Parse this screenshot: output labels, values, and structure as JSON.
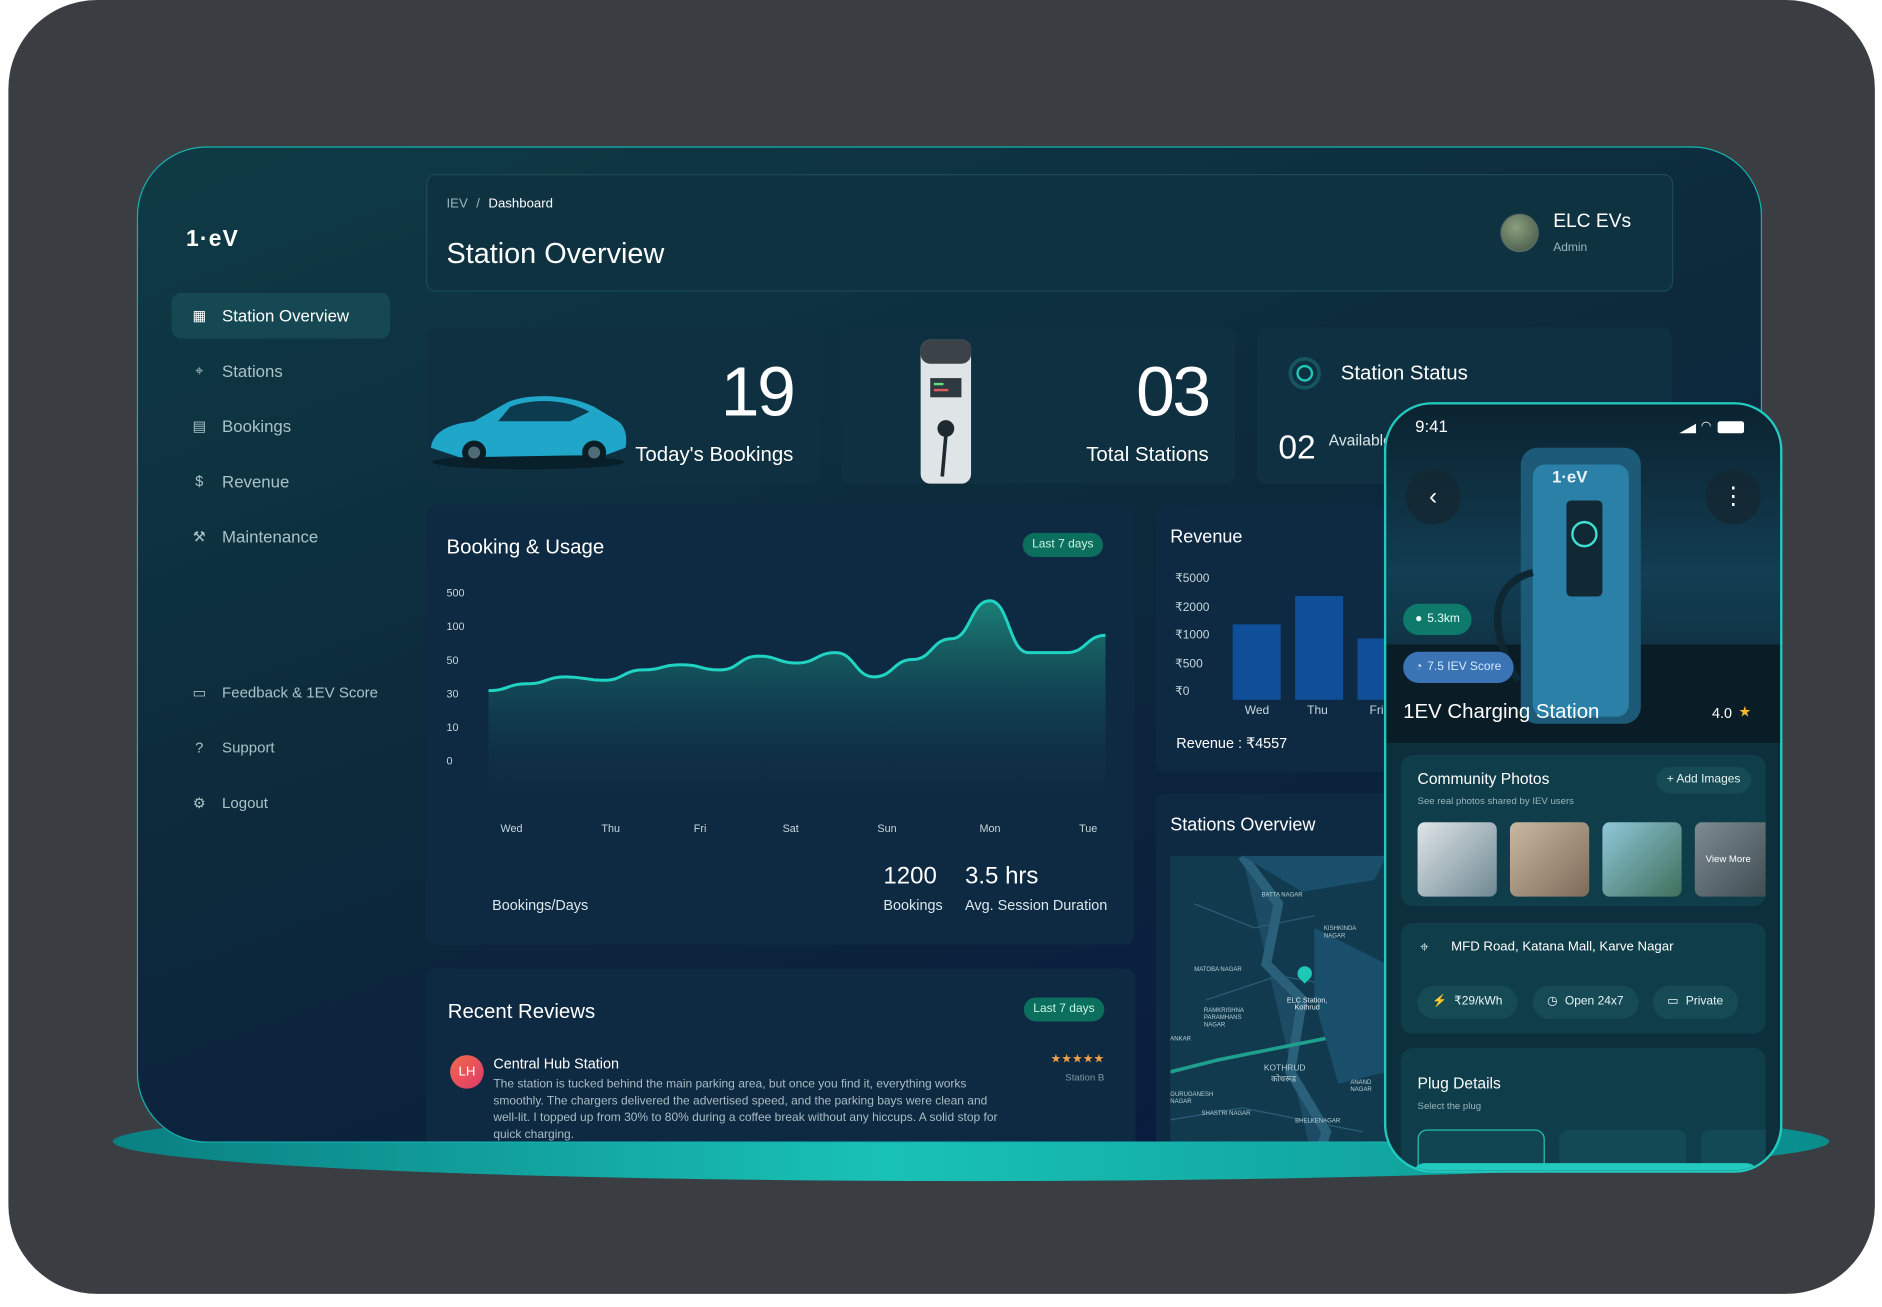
{
  "app": {
    "logo": "1·eV"
  },
  "nav": {
    "items": [
      {
        "label": "Station Overview",
        "icon": "grid-icon",
        "active": true
      },
      {
        "label": "Stations",
        "icon": "map-pin-icon"
      },
      {
        "label": "Bookings",
        "icon": "calendar-icon"
      },
      {
        "label": "Revenue",
        "icon": "dollar-icon"
      },
      {
        "label": "Maintenance",
        "icon": "wrench-icon"
      }
    ],
    "lower_items": [
      {
        "label": "Feedback & 1EV Score",
        "icon": "chat-icon"
      },
      {
        "label": "Support",
        "icon": "help-icon"
      },
      {
        "label": "Logout",
        "icon": "gear-icon"
      }
    ]
  },
  "header": {
    "breadcrumb_root": "IEV",
    "breadcrumb_sep": "/",
    "breadcrumb_current": "Dashboard",
    "title": "Station Overview",
    "user_name": "ELC EVs",
    "user_role": "Admin"
  },
  "cards": {
    "bookings": {
      "value": "19",
      "label": "Today's Bookings"
    },
    "stations": {
      "value": "03",
      "label": "Total Stations"
    },
    "status": {
      "title": "Station Status",
      "value": "02",
      "label": "Available"
    }
  },
  "booking_usage": {
    "title": "Booking & Usage",
    "range": "Last 7 days",
    "footer_label": "Bookings/Days",
    "bookings_value": "1200",
    "bookings_label": "Bookings",
    "duration_value": "3.5 hrs",
    "duration_label": "Avg. Session Duration"
  },
  "revenue": {
    "title": "Revenue",
    "total_label": "Revenue : ₹4557"
  },
  "stations_overview": {
    "title": "Stations Overview",
    "map_labels": [
      "BATTA NAGAR",
      "KISHKINDA NAGAR",
      "MATOBA NAGAR",
      "RAMKRISHNA PARAMHANS NAGAR",
      "ELC Station, Kothrud",
      "KOTHRUD",
      "कोथरूड",
      "SHASTRI NAGAR",
      "ANAND NAGAR",
      "BHELKENAGAR",
      "GURUGANESH NAGAR",
      "ANKAR"
    ]
  },
  "reviews": {
    "title": "Recent Reviews",
    "range": "Last 7 days",
    "items": [
      {
        "initials": "LH",
        "station": "Central Hub Station",
        "stars": "★★★★★",
        "tag": "Station B",
        "text": "The station is tucked behind the main parking area, but once you find it, everything works smoothly. The chargers delivered the advertised speed, and the parking bays were clean and well-lit. I topped up from 30% to 80% during a coffee break without any hiccups. A solid stop for quick charging."
      }
    ]
  },
  "phone": {
    "time": "9:41",
    "distance": "5.3km",
    "score": "7.5 IEV Score",
    "station_name": "1EV Charging Station",
    "rating": "4.0",
    "star": "★",
    "photos_title": "Community Photos",
    "add_images": "+ Add Images",
    "photos_sub": "See real photos shared by IEV users",
    "view_more": "View More",
    "address": "MFD Road, Katana Mall, Karve Nagar",
    "chips": [
      "₹29/kWh",
      "Open 24x7",
      "Private"
    ],
    "plug_title": "Plug Details",
    "plug_sub": "Select the plug",
    "brand": "1·eV"
  },
  "chart_data": [
    {
      "type": "area",
      "title": "Booking & Usage",
      "xlabel": "Bookings/Days",
      "categories": [
        "Wed",
        "Thu",
        "Fri",
        "Sat",
        "Sun",
        "Mon",
        "Tue"
      ],
      "yticks": [
        "500",
        "100",
        "50",
        "30",
        "10",
        "0"
      ],
      "series": [
        {
          "values": [
            40,
            44,
            48,
            46,
            52,
            55,
            52,
            60,
            56,
            62,
            48,
            58,
            70,
            92,
            62,
            62,
            72
          ]
        }
      ],
      "ylim": [
        0,
        100
      ],
      "color": "#20d3c2"
    },
    {
      "type": "bar",
      "title": "Revenue",
      "categories": [
        "Wed",
        "Thu",
        "Fri"
      ],
      "values": [
        800,
        1100,
        650
      ],
      "yticks": [
        "₹5000",
        "₹2000",
        "₹1000",
        "₹500",
        "₹0"
      ],
      "color": "#0f4f9a"
    }
  ]
}
